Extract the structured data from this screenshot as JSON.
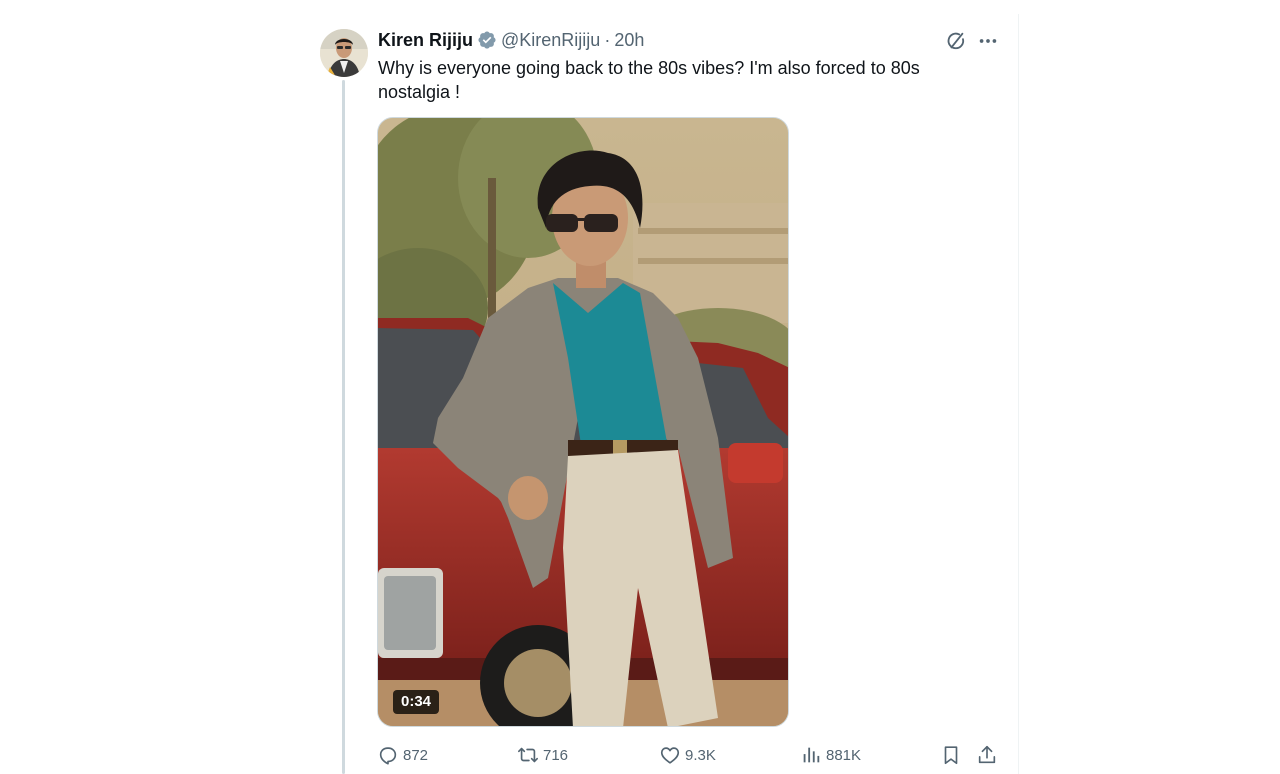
{
  "tweet": {
    "author": {
      "display_name": "Kiren Rijiju",
      "handle": "@KirenRijiju",
      "verified": true,
      "avatar_icon": "avatar-photo"
    },
    "separator": "·",
    "time_ago": "20h",
    "text": "Why is everyone going back to the 80s vibes? I'm also forced to 80s nostalgia !",
    "media": {
      "type": "video",
      "duration": "0:34"
    },
    "metrics": {
      "replies": "872",
      "reposts": "716",
      "likes": "9.3K",
      "views": "881K"
    },
    "icons": {
      "verified": "verified-badge-icon",
      "grok": "grok-icon",
      "more": "more-icon",
      "reply": "reply-icon",
      "repost": "repost-icon",
      "like": "like-icon",
      "views": "views-icon",
      "bookmark": "bookmark-icon",
      "share": "share-icon"
    },
    "colors": {
      "text": "#0f1419",
      "secondary": "#536471",
      "verified": "#829aab",
      "border": "#cfd9de"
    }
  }
}
